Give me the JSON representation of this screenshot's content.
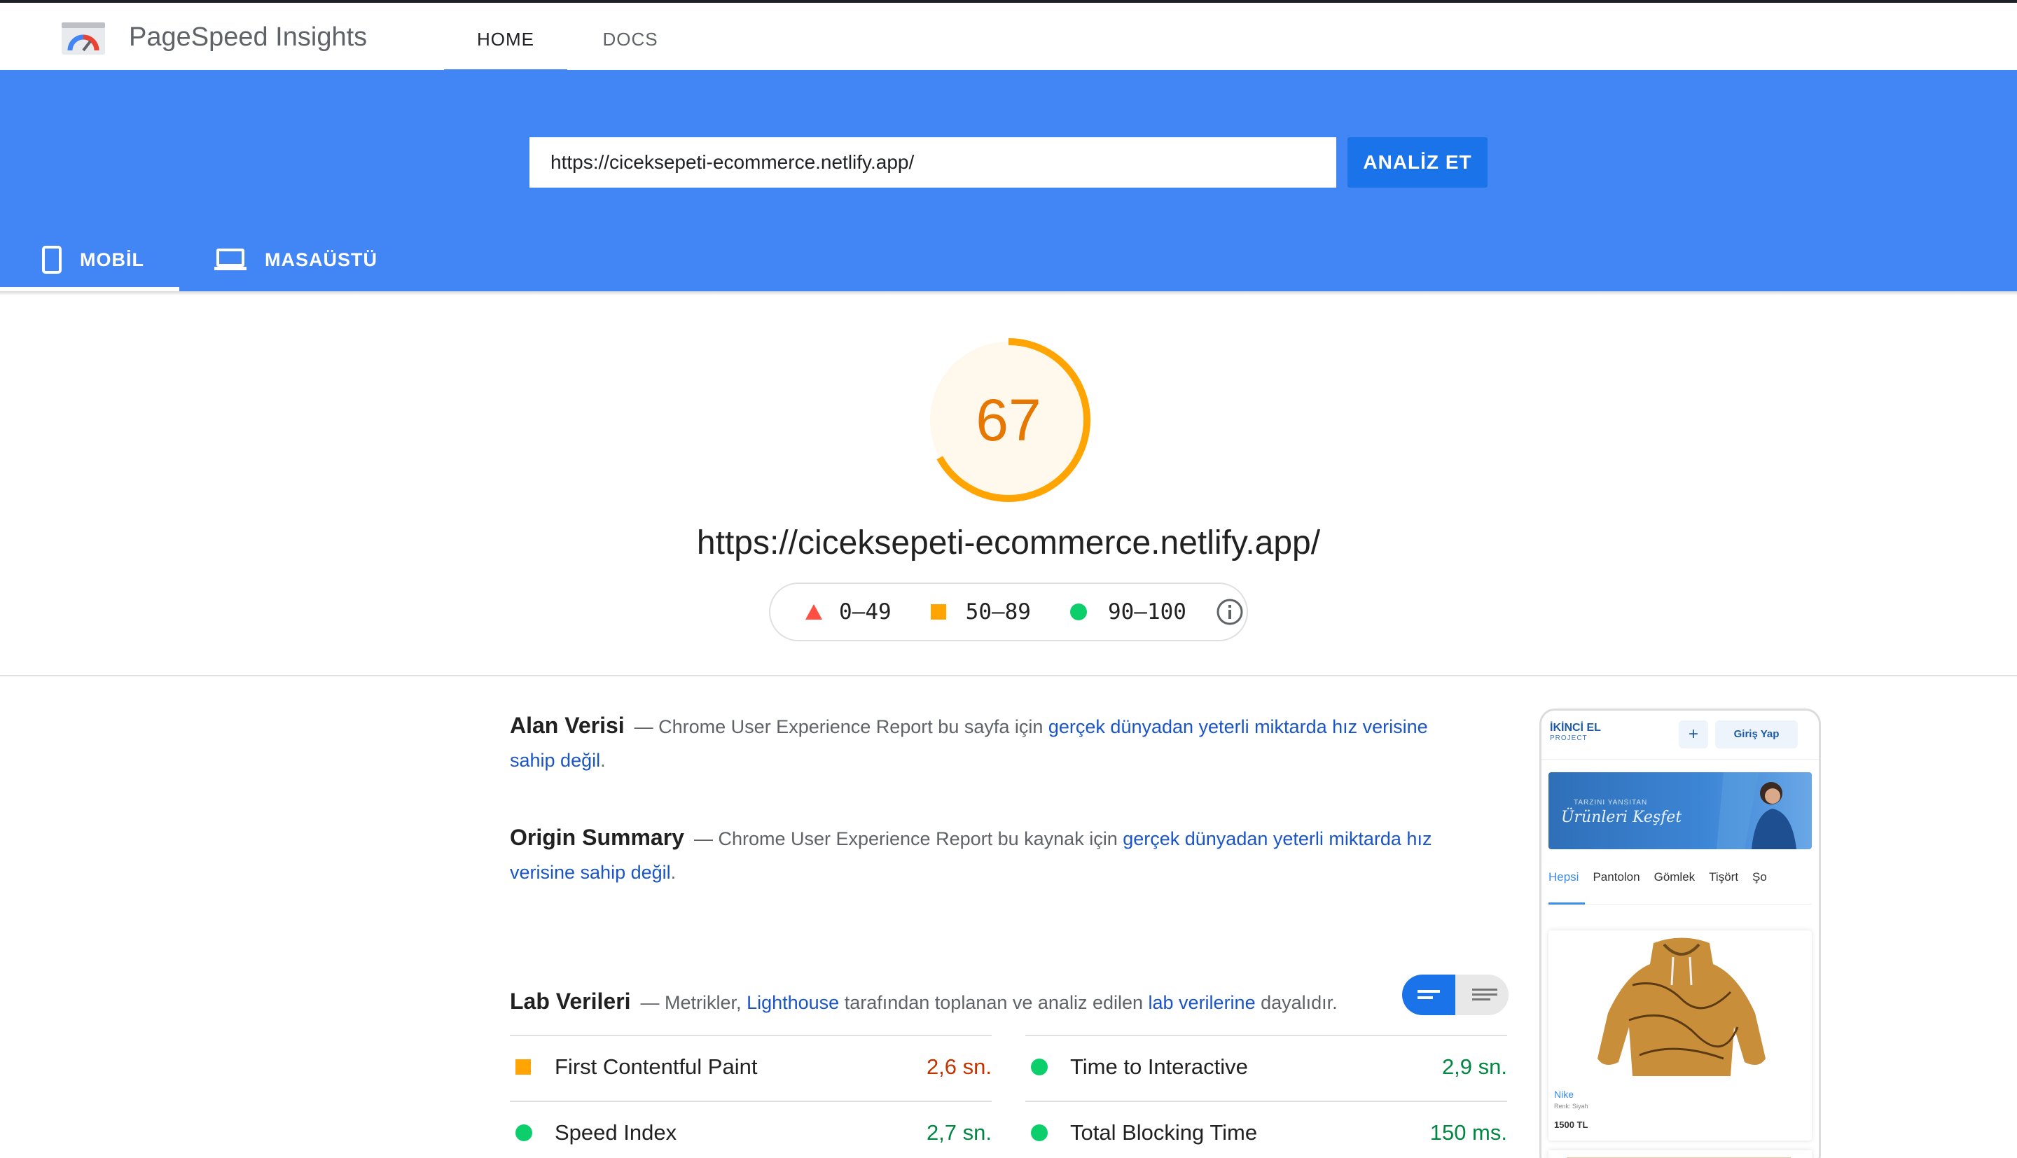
{
  "app": {
    "title": "PageSpeed Insights",
    "nav": [
      {
        "label": "HOME",
        "active": true
      },
      {
        "label": "DOCS",
        "active": false
      }
    ]
  },
  "search": {
    "url_value": "https://ciceksepeti-ecommerce.netlify.app/",
    "analyze_label": "ANALİZ ET"
  },
  "device_tabs": [
    {
      "label": "MOBİL",
      "icon": "smartphone-icon",
      "active": true
    },
    {
      "label": "MASAÜSTÜ",
      "icon": "laptop-icon",
      "active": false
    }
  ],
  "report": {
    "score": "67",
    "score_fraction": 0.67,
    "score_color": "#ffa400",
    "tested_url": "https://ciceksepeti-ecommerce.netlify.app/",
    "legend": [
      {
        "range": "0–49",
        "shape": "triangle",
        "color": "#ff4e42"
      },
      {
        "range": "50–89",
        "shape": "square",
        "color": "#ffa400"
      },
      {
        "range": "90–100",
        "shape": "circle",
        "color": "#0cce6b"
      }
    ]
  },
  "field_data": {
    "heading": "Alan Verisi",
    "text_prefix": "— Chrome User Experience Report bu sayfa için ",
    "link_text": "gerçek dünyadan yeterli miktarda hız verisine sahip değil",
    "text_suffix": "."
  },
  "origin_summary": {
    "heading": "Origin Summary",
    "text_prefix": "— Chrome User Experience Report bu kaynak için ",
    "link_text": "gerçek dünyadan yeterli miktarda hız verisine sahip değil",
    "text_suffix": "."
  },
  "lab_data": {
    "heading": "Lab Verileri",
    "text_prefix": "— Metrikler, ",
    "link1": "Lighthouse",
    "text_middle": " tarafından toplanan ve analiz edilen ",
    "link2": "lab verilerine",
    "text_suffix": " dayalıdır.",
    "metrics": [
      {
        "label": "First Contentful Paint",
        "value": "2,6 sn.",
        "status": "average",
        "color": "#c33300"
      },
      {
        "label": "Time to Interactive",
        "value": "2,9 sn.",
        "status": "pass",
        "color": "#018642"
      },
      {
        "label": "Speed Index",
        "value": "2,7 sn.",
        "status": "pass",
        "color": "#018642"
      },
      {
        "label": "Total Blocking Time",
        "value": "150 ms.",
        "status": "pass",
        "color": "#018642"
      }
    ]
  },
  "thumbnail": {
    "logo": "İKİNCİ EL",
    "logo_sub": "PROJECT",
    "plus_label": "+",
    "login_label": "Giriş Yap",
    "banner_small": "TARZINI YANSITAN",
    "banner_big": "Ürünleri Keşfet",
    "categories": [
      "Hepsi",
      "Pantolon",
      "Gömlek",
      "Tişört",
      "Şo"
    ],
    "product_brand": "Nike",
    "product_desc": "Renk: Siyah",
    "product_price": "1500 TL"
  },
  "colors": {
    "brand_blue": "#4285f4",
    "button_blue": "#1a73e8",
    "link_blue": "#1a55c7"
  }
}
